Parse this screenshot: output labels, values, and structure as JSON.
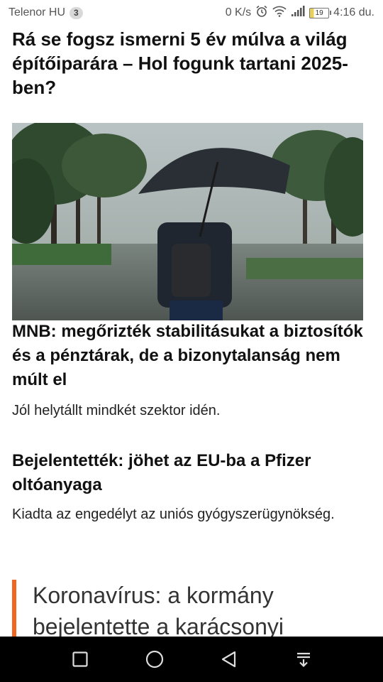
{
  "status_bar": {
    "carrier": "Telenor HU",
    "notification_count": "3",
    "network_speed": "0 K/s",
    "battery": "19",
    "time": "4:16 du."
  },
  "articles": [
    {
      "headline": "Rá se fogsz ismerni 5 év múlva a világ építőiparára – Hol fogunk tartani 2025-ben?"
    },
    {
      "headline": "MNB: megőrizték stabilitásukat a biztosítók és a pénztárak, de a bizonytalanság nem múlt el",
      "lead": "Jól helytállt mindkét szektor idén."
    },
    {
      "headline": "Bejelentették: jöhet az EU-ba a Pfizer oltóanyaga",
      "lead": "Kiadta az engedélyt az uniós gyógyszerügynökség."
    },
    {
      "headline": "Koronavírus: a kormány bejelentette a karácsonyi"
    }
  ],
  "colors": {
    "accent": "#f26522",
    "navbar": "#000000"
  },
  "nav_bar": [
    "recents-icon",
    "home-icon",
    "back-icon",
    "notification-pull-icon"
  ]
}
